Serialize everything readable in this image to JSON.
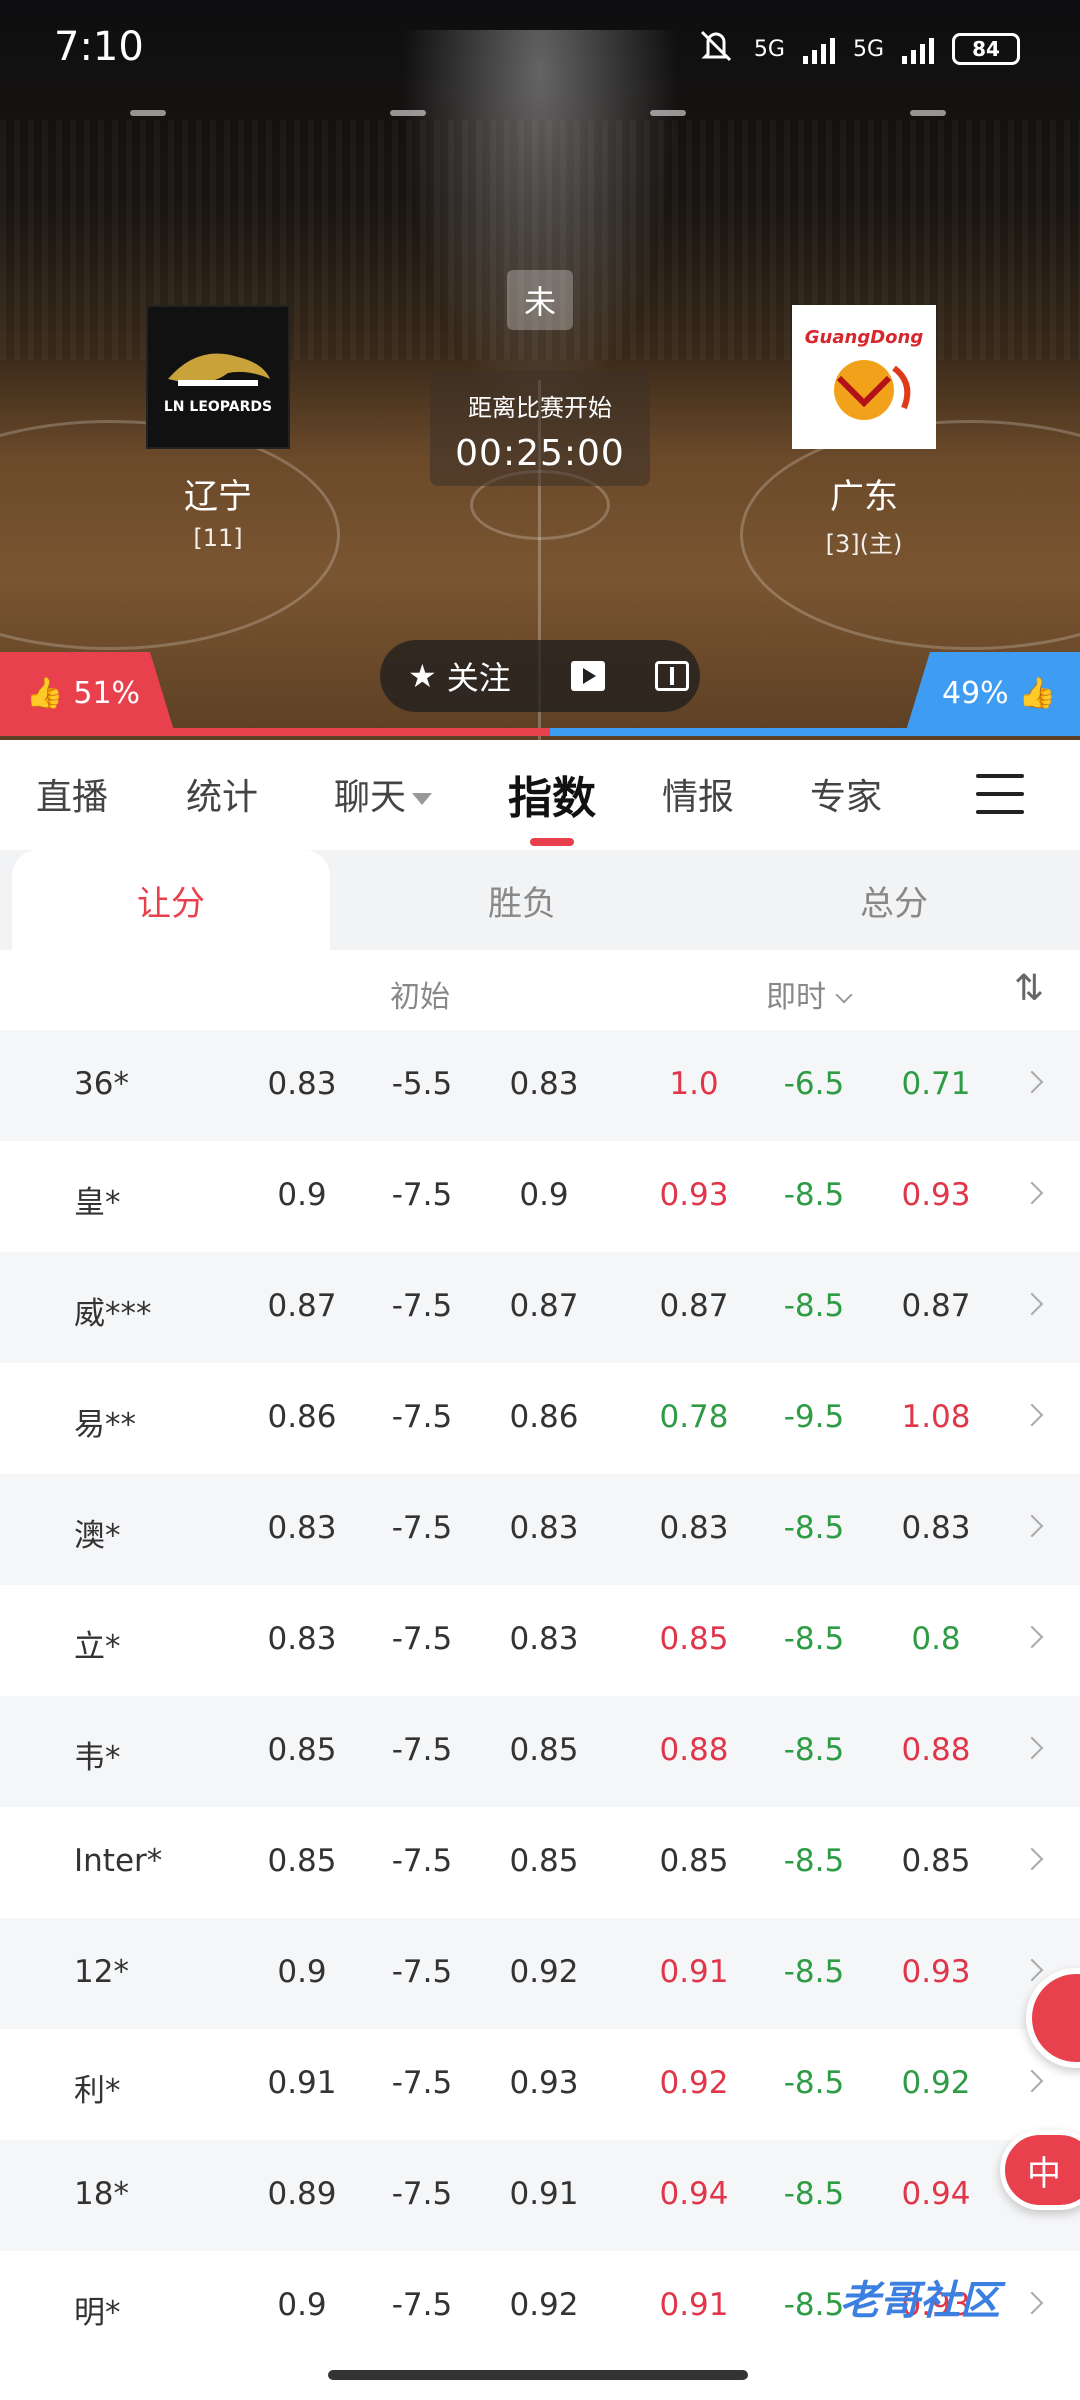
{
  "status_bar": {
    "time": "7:10",
    "net1": "5G",
    "net2": "5G",
    "battery": "84"
  },
  "match": {
    "status": "未",
    "countdown_label": "距离比赛开始",
    "countdown": "00:25:00",
    "away": {
      "name": "辽宁",
      "rank": "[11]",
      "logo_text": "LN LEOPARDS"
    },
    "home": {
      "name": "广东",
      "rank": "[3](主)",
      "logo_text": "GuangDong"
    }
  },
  "votes": {
    "left": "51%",
    "right": "49%"
  },
  "actions": {
    "follow": "关注"
  },
  "tabs": [
    {
      "label": "直播"
    },
    {
      "label": "统计"
    },
    {
      "label": "聊天"
    },
    {
      "label": "指数"
    },
    {
      "label": "情报"
    },
    {
      "label": "专家"
    }
  ],
  "sub_tabs": [
    {
      "label": "让分"
    },
    {
      "label": "胜负"
    },
    {
      "label": "总分"
    }
  ],
  "columns": {
    "initial": "初始",
    "live": "即时",
    "sort": "⇅"
  },
  "colors": {
    "accent": "#e8414d",
    "home_blue": "#3f9cf3",
    "up": "#e0364a",
    "down": "#2e9c45"
  },
  "rows": [
    {
      "company": "36*",
      "init": [
        "0.83",
        "-5.5",
        "0.83"
      ],
      "live": [
        "1.0",
        "-6.5",
        "0.71"
      ],
      "cls": [
        "red",
        "green",
        "green"
      ]
    },
    {
      "company": "皇*",
      "init": [
        "0.9",
        "-7.5",
        "0.9"
      ],
      "live": [
        "0.93",
        "-8.5",
        "0.93"
      ],
      "cls": [
        "red",
        "green",
        "red"
      ]
    },
    {
      "company": "威***",
      "init": [
        "0.87",
        "-7.5",
        "0.87"
      ],
      "live": [
        "0.87",
        "-8.5",
        "0.87"
      ],
      "cls": [
        "neutral",
        "green",
        "neutral"
      ]
    },
    {
      "company": "易**",
      "init": [
        "0.86",
        "-7.5",
        "0.86"
      ],
      "live": [
        "0.78",
        "-9.5",
        "1.08"
      ],
      "cls": [
        "green",
        "green",
        "red"
      ]
    },
    {
      "company": "澳*",
      "init": [
        "0.83",
        "-7.5",
        "0.83"
      ],
      "live": [
        "0.83",
        "-8.5",
        "0.83"
      ],
      "cls": [
        "neutral",
        "green",
        "neutral"
      ]
    },
    {
      "company": "立*",
      "init": [
        "0.83",
        "-7.5",
        "0.83"
      ],
      "live": [
        "0.85",
        "-8.5",
        "0.8"
      ],
      "cls": [
        "red",
        "green",
        "green"
      ]
    },
    {
      "company": "韦*",
      "init": [
        "0.85",
        "-7.5",
        "0.85"
      ],
      "live": [
        "0.88",
        "-8.5",
        "0.88"
      ],
      "cls": [
        "red",
        "green",
        "red"
      ]
    },
    {
      "company": "Inter*",
      "init": [
        "0.85",
        "-7.5",
        "0.85"
      ],
      "live": [
        "0.85",
        "-8.5",
        "0.85"
      ],
      "cls": [
        "neutral",
        "green",
        "neutral"
      ]
    },
    {
      "company": "12*",
      "init": [
        "0.9",
        "-7.5",
        "0.92"
      ],
      "live": [
        "0.91",
        "-8.5",
        "0.93"
      ],
      "cls": [
        "red",
        "green",
        "red"
      ]
    },
    {
      "company": "利*",
      "init": [
        "0.91",
        "-7.5",
        "0.93"
      ],
      "live": [
        "0.92",
        "-8.5",
        "0.92"
      ],
      "cls": [
        "red",
        "green",
        "green"
      ]
    },
    {
      "company": "18*",
      "init": [
        "0.89",
        "-7.5",
        "0.91"
      ],
      "live": [
        "0.94",
        "-8.5",
        "0.94"
      ],
      "cls": [
        "red",
        "green",
        "red"
      ]
    },
    {
      "company": "明*",
      "init": [
        "0.9",
        "-7.5",
        "0.92"
      ],
      "live": [
        "0.91",
        "-8.5",
        "0.93"
      ],
      "cls": [
        "red",
        "green",
        "red"
      ]
    }
  ],
  "floating": {
    "chat_label": "中"
  },
  "watermark": "老哥社区"
}
